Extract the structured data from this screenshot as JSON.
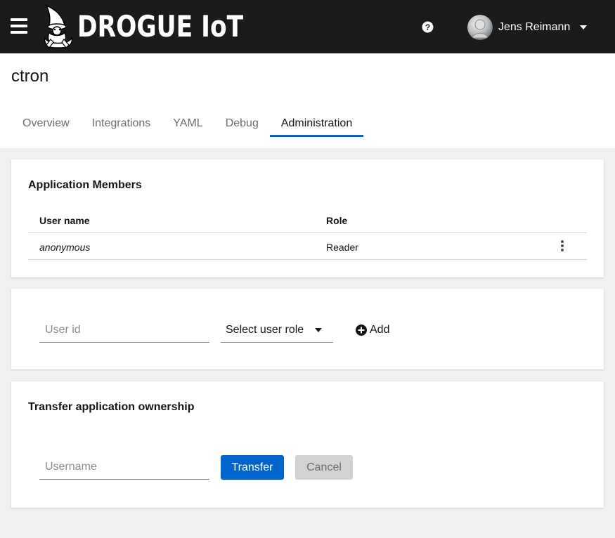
{
  "masthead": {
    "logo_text": "DROGUE IoT",
    "user_name": "Jens Reimann"
  },
  "page": {
    "title": "ctron"
  },
  "tabs": [
    {
      "label": "Overview",
      "active": false
    },
    {
      "label": "Integrations",
      "active": false
    },
    {
      "label": "YAML",
      "active": false
    },
    {
      "label": "Debug",
      "active": false
    },
    {
      "label": "Administration",
      "active": true
    }
  ],
  "members": {
    "title": "Application Members",
    "columns": [
      "User name",
      "Role"
    ],
    "rows": [
      {
        "user": "anonymous",
        "role": "Reader"
      }
    ]
  },
  "add_member": {
    "user_id_placeholder": "User id",
    "role_select": "Select user role",
    "add_label": "Add"
  },
  "transfer": {
    "title": "Transfer application ownership",
    "username_placeholder": "Username",
    "transfer_label": "Transfer",
    "cancel_label": "Cancel"
  },
  "colors": {
    "masthead_bg": "#1b1b1b",
    "primary": "#0066cc",
    "page_bg": "#f0f0f0"
  },
  "icons": [
    "hamburger-icon",
    "drogue-gnome-logo",
    "help-icon",
    "avatar",
    "caret-down-icon",
    "kebab-icon",
    "plus-circle-icon"
  ]
}
